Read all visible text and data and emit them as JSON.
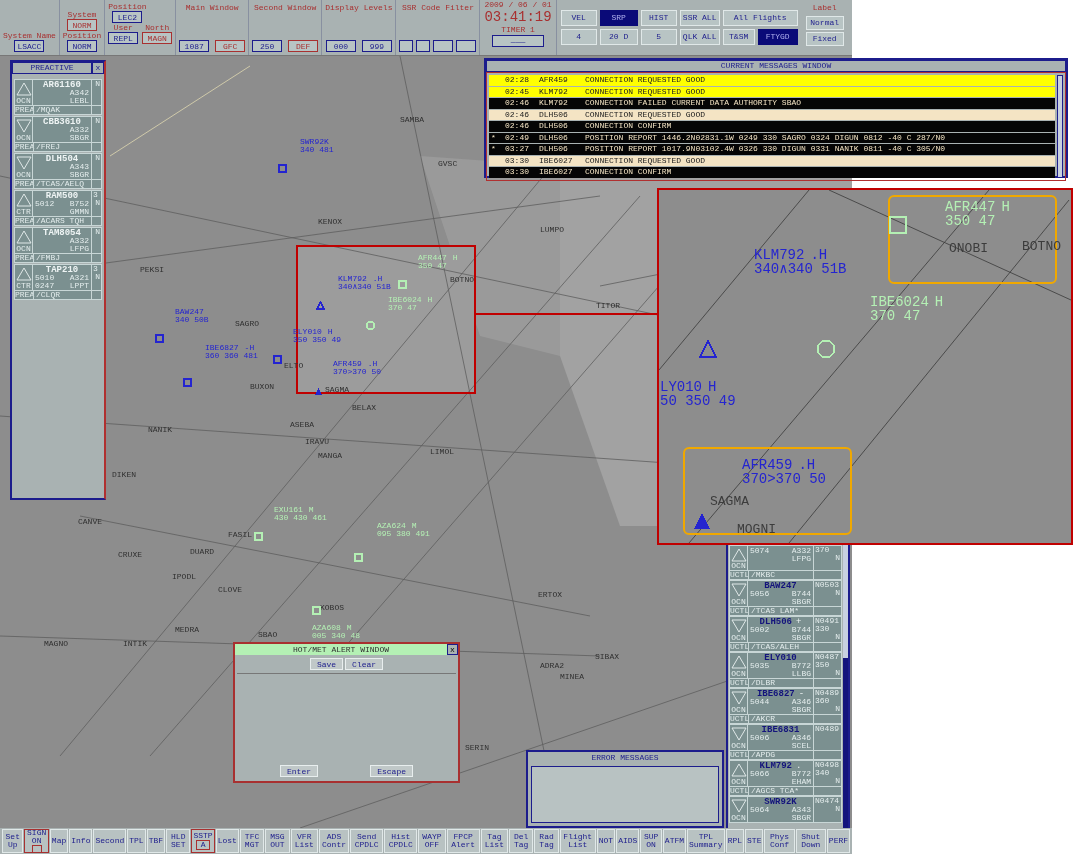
{
  "topbar": {
    "groups": [
      {
        "fields": [
          {
            "label": "System Name",
            "value": "LSACC",
            "kind": "control"
          }
        ]
      },
      {
        "fields": [
          {
            "label": "System",
            "value": "NORM",
            "kind": "setting"
          },
          {
            "label": "Position",
            "value": "NORM",
            "kind": "control"
          }
        ]
      },
      {
        "fields": [
          {
            "label": "Position",
            "value": "LEC2",
            "kind": "control"
          },
          {
            "label": "User",
            "value": "REPL",
            "kind": "control"
          },
          {
            "label": "North",
            "value": "MAGN",
            "kind": "setting"
          }
        ]
      },
      {
        "title": "Main Window",
        "fields": [
          {
            "value": "1087",
            "kind": "control"
          },
          {
            "value": "GFC",
            "kind": "setting"
          }
        ]
      },
      {
        "title": "Second Window",
        "fields": [
          {
            "value": "250",
            "kind": "control"
          },
          {
            "value": "DEF",
            "kind": "setting"
          }
        ]
      },
      {
        "title": "Display Levels",
        "fields": [
          {
            "value": "000",
            "kind": "control"
          },
          {
            "value": "999",
            "kind": "control"
          }
        ]
      },
      {
        "title": "SSR Code Filter"
      }
    ],
    "date": "2009 / 06 / 01",
    "time": "03:41:19",
    "timer_label": "TIMER 1",
    "timer_button": "———",
    "buttons": [
      {
        "label": "VEL",
        "selected": false
      },
      {
        "label": "SRP",
        "selected": true
      },
      {
        "label": "HIST",
        "selected": false
      },
      {
        "label": "SSR ALL",
        "selected": false
      },
      {
        "label": "All Flights",
        "selected": false
      },
      {
        "label": "4",
        "selected": false
      },
      {
        "label": "20 D",
        "selected": false
      },
      {
        "label": "5",
        "selected": false
      },
      {
        "label": "QLK ALL",
        "selected": false
      },
      {
        "label": "T&SM",
        "selected": false
      },
      {
        "label": "FTYGD",
        "selected": true
      }
    ],
    "label_group": {
      "title": "Label",
      "buttons": [
        "Normal",
        "Fixed"
      ]
    }
  },
  "preactive": {
    "title": "PREACTIVE",
    "close": "x",
    "strips": [
      {
        "kind": "up",
        "callsign": "AR61160",
        "type": "A342",
        "dest": "LEBL",
        "sector": "OCN",
        "status": "PREA",
        "info": "/MQAK",
        "tag": "N"
      },
      {
        "kind": "down",
        "callsign": "CBB3610",
        "type": "A332",
        "dest": "SBGR",
        "sector": "OCN",
        "status": "PREA",
        "info": "/FREJ",
        "tag": "N"
      },
      {
        "kind": "down",
        "callsign": "DLH504",
        "type": "A343",
        "dest": "SBGR",
        "sector": "OCN",
        "status": "PREA",
        "info": "/TCAS/AELQ",
        "tag": "N"
      },
      {
        "kind": "up",
        "callsign": "RAM500",
        "ssr": "5012",
        "type": "B752",
        "dest": "GMMN",
        "sector": "CTR",
        "status": "PREA",
        "info": "/ACARS TQH",
        "tag": "N",
        "level": "3"
      },
      {
        "kind": "up",
        "callsign": "TAM8054",
        "type": "A332",
        "dest": "LFPG",
        "sector": "OCN",
        "status": "PREA",
        "info": "/FMBJ",
        "tag": "N"
      },
      {
        "kind": "up",
        "callsign": "TAP210",
        "ssr": "5010",
        "type": "A321",
        "eta": "0247",
        "dest": "LPPT",
        "sector": "CTR",
        "status": "PREA",
        "info": "/CLQR",
        "tag": "N",
        "level": "3"
      }
    ]
  },
  "messages": {
    "title": "CURRENT MESSAGES WINDOW",
    "rows": [
      {
        "time": "02:28",
        "callsign": "AFR459",
        "text": "CONNECTION REQUESTED GOOD",
        "kind": "alert"
      },
      {
        "time": "02:45",
        "callsign": "KLM792",
        "text": "CONNECTION REQUESTED GOOD",
        "kind": "alert"
      },
      {
        "time": "02:46",
        "callsign": "KLM792",
        "text": "CONNECTION FAILED CURRENT DATA AUTHORITY SBAO",
        "kind": "normal"
      },
      {
        "time": "02:46",
        "callsign": "DLH506",
        "text": "CONNECTION REQUESTED GOOD",
        "kind": "notice"
      },
      {
        "time": "02:46",
        "callsign": "DLH506",
        "text": "CONNECTION CONFIRM",
        "kind": "normal"
      },
      {
        "marker": "*",
        "time": "02:49",
        "callsign": "DLH506",
        "text": "POSITION REPORT 1446.2N02831.1W 0249 330 SAGRO 0324 DIGUN 0812 -40 C 287/N0",
        "kind": "normal"
      },
      {
        "marker": "*",
        "time": "03:27",
        "callsign": "DLH506",
        "text": "POSITION REPORT 1017.9N03102.4W 0326 330 DIGUN 0331 NANIK 0811 -40 C 305/N0",
        "kind": "normal"
      },
      {
        "time": "03:30",
        "callsign": "IBE6027",
        "text": "CONNECTION REQUESTED GOOD",
        "kind": "notice"
      },
      {
        "time": "03:30",
        "callsign": "IBE6027",
        "text": "CONNECTION CONFIRM",
        "kind": "normal"
      }
    ]
  },
  "map": {
    "waypoints": [
      {
        "name": "SAMBA"
      },
      {
        "name": "KENOX"
      },
      {
        "name": "PEKSI"
      },
      {
        "name": "SAGRO"
      },
      {
        "name": "ELTO"
      },
      {
        "name": "BUXON"
      },
      {
        "name": "NANIK"
      },
      {
        "name": "BELAX"
      },
      {
        "name": "ASEBA"
      },
      {
        "name": "IRAVU"
      },
      {
        "name": "MANGA"
      },
      {
        "name": "DIKEN"
      },
      {
        "name": "LIMOL"
      },
      {
        "name": "CANVE"
      },
      {
        "name": "CRUXE"
      },
      {
        "name": "FASIL"
      },
      {
        "name": "DUARD"
      },
      {
        "name": "IPODL"
      },
      {
        "name": "CLOVE"
      },
      {
        "name": "KOBOS"
      },
      {
        "name": "SBAO"
      },
      {
        "name": "ERTOX"
      },
      {
        "name": "ADRA2"
      },
      {
        "name": "MINEA"
      },
      {
        "name": "SIBAX"
      },
      {
        "name": "SERIN"
      },
      {
        "name": "MAGNO"
      },
      {
        "name": "INTIK"
      },
      {
        "name": "MEDRA"
      },
      {
        "name": "LUMPO"
      },
      {
        "name": "TITOR"
      },
      {
        "name": "GVSC"
      },
      {
        "name": "BOTNO"
      },
      {
        "name": "SAGMA"
      }
    ],
    "tracks": [
      {
        "callsign": "SWR92K",
        "data": "340 481",
        "color": "#2424d0",
        "kind": "square"
      },
      {
        "callsign": "BAW247",
        "data": "340 50B",
        "color": "#2424d0",
        "kind": "square"
      },
      {
        "callsign": "IBE6827",
        "suffix": "-H",
        "data": "360 360 481",
        "color": "#2424d0",
        "kind": "square"
      },
      {
        "callsign": "KLM792",
        "suffix": ".H",
        "data": "340∧340 51B",
        "color": "#2424d0",
        "kind": "triangle"
      },
      {
        "callsign": "AFR447",
        "suffix": "H",
        "data": "350 47",
        "color": "#b4f0b4",
        "kind": "square"
      },
      {
        "callsign": "IBE6024",
        "suffix": "H",
        "data": "370 47",
        "color": "#b4f0b4",
        "kind": "octagon"
      },
      {
        "callsign": "ELY010",
        "suffix": "H",
        "data": "350 350 49",
        "color": "#2424d0",
        "kind": "square"
      },
      {
        "callsign": "AFR459",
        "suffix": ".H",
        "data": "370>370 50",
        "color": "#2424d0",
        "kind": "filled"
      },
      {
        "callsign": "EXU161",
        "suffix": "M",
        "data": "430 430 461",
        "color": "#b4f0b4",
        "kind": "square"
      },
      {
        "callsign": "AZA624",
        "suffix": "M",
        "data": "095 380 491",
        "color": "#b4f0b4",
        "kind": "square"
      },
      {
        "callsign": "AZA608",
        "suffix": "M",
        "data": "005 340 48",
        "color": "#b4f0b4",
        "kind": "square"
      }
    ]
  },
  "active": {
    "strips": [
      {
        "kind": "up",
        "ssr": "5074",
        "type": "A332",
        "level": "370",
        "dest": "LFPG",
        "flag": "N",
        "sector": "OCN",
        "status": "UCTL",
        "info": "/MKBC"
      },
      {
        "kind": "down",
        "callsign": "BAW247",
        "ssr": "5056",
        "type": "B744",
        "speed": "N0503",
        "dest": "SBGR",
        "flag": "N",
        "sector": "OCN",
        "status": "UCTL",
        "info": "/TCAS LAM*"
      },
      {
        "kind": "down",
        "callsign": "DLH506",
        "mark": "+",
        "ssr": "5002",
        "type": "B744",
        "speed": "N0491",
        "level": "330",
        "dest": "SBGR",
        "flag": "N",
        "sector": "OCN",
        "status": "UCTL",
        "info": "/TCAS/ALEH"
      },
      {
        "kind": "up",
        "callsign": "ELY010",
        "ssr": "5035",
        "type": "B772",
        "speed": "N0487",
        "level": "350",
        "dest": "LLBG",
        "flag": "N",
        "sector": "OCN",
        "status": "UCTL",
        "info": "/DLBR"
      },
      {
        "kind": "down",
        "callsign": "IBE6827",
        "mark": "-",
        "ssr": "5044",
        "type": "A346",
        "speed": "N0489",
        "level": "360",
        "dest": "SBGR",
        "flag": "N",
        "sector": "OCN",
        "status": "UCTL",
        "info": "/AKCR"
      },
      {
        "kind": "down",
        "callsign": "IBE6831",
        "ssr": "5006",
        "type": "A346",
        "speed": "N0489",
        "dest": "SCEL",
        "sector": "OCN",
        "status": "UCTL",
        "info": "/APDG"
      },
      {
        "kind": "up",
        "callsign": "KLM792",
        "mark": ".",
        "ssr": "5066",
        "type": "B772",
        "speed": "N0498",
        "level": "340",
        "dest": "EHAM",
        "flag": "N",
        "sector": "OCN",
        "status": "UCTL",
        "info": "/AGCS TCA*"
      },
      {
        "kind": "down",
        "callsign": "SWR92K",
        "ssr": "5064",
        "type": "A343",
        "speed": "N0474",
        "dest": "SBGR",
        "flag": "N",
        "sector": "OCN"
      }
    ]
  },
  "hotmet": {
    "title": "HOT/MET ALERT WINDOW",
    "close": "x",
    "buttons": [
      "Save",
      "Clear"
    ],
    "footer_buttons": [
      "Enter",
      "Escape"
    ]
  },
  "errors": {
    "title": "ERROR MESSAGES"
  },
  "bottombar": {
    "buttons": [
      {
        "label": "Set Up",
        "kind": "plain"
      },
      {
        "label": "SIGN ON",
        "kind": "split"
      },
      {
        "label": "Map",
        "kind": "plain"
      },
      {
        "label": "Info",
        "kind": "plain"
      },
      {
        "label": "Second",
        "kind": "plain"
      },
      {
        "label": "TPL",
        "kind": "plain"
      },
      {
        "label": "TBF",
        "kind": "plain"
      },
      {
        "label": "HLD SET",
        "kind": "plain"
      },
      {
        "label": "SSTP",
        "kind": "split",
        "sub": "A"
      },
      {
        "label": "Lost",
        "kind": "plain"
      },
      {
        "label": "TFC MGT",
        "kind": "plain"
      },
      {
        "label": "MSG OUT",
        "kind": "plain"
      },
      {
        "label": "VFR List",
        "kind": "plain"
      },
      {
        "label": "ADS Contr",
        "kind": "plain"
      },
      {
        "label": "Send CPDLC",
        "kind": "plain"
      },
      {
        "label": "Hist CPDLC",
        "kind": "plain"
      },
      {
        "label": "WAYP OFF",
        "kind": "plain"
      },
      {
        "label": "FPCP Alert",
        "kind": "plain"
      },
      {
        "label": "Tag List",
        "kind": "plain"
      },
      {
        "label": "Del Tag",
        "kind": "plain"
      },
      {
        "label": "Rad Tag",
        "kind": "plain"
      },
      {
        "label": "Flight List",
        "kind": "plain"
      },
      {
        "label": "NOT",
        "kind": "plain"
      },
      {
        "label": "AIDS",
        "kind": "plain"
      },
      {
        "label": "SUP ON",
        "kind": "plain"
      },
      {
        "label": "ATFM",
        "kind": "plain"
      },
      {
        "label": "TPL Summary",
        "kind": "plain"
      },
      {
        "label": "RPL",
        "kind": "plain"
      },
      {
        "label": "STE",
        "kind": "plain"
      },
      {
        "label": "Phys Conf",
        "kind": "plain"
      },
      {
        "label": "Shut Down",
        "kind": "plain"
      },
      {
        "label": "PERF",
        "kind": "plain"
      }
    ]
  },
  "inset": {
    "waypoints": [
      {
        "name": "ONOBI"
      },
      {
        "name": "BOTNO"
      },
      {
        "name": "SAGMA"
      },
      {
        "name": "MOGNI"
      }
    ],
    "tracks": [
      {
        "callsign": "KLM792",
        "suffix": ".H",
        "data": "340∧340 51B",
        "color": "#2424d0",
        "kind": "triangle",
        "highlighted": false
      },
      {
        "callsign": "AFR447",
        "suffix": "H",
        "data": "350 47",
        "color": "#b4f0b4",
        "kind": "square",
        "highlighted": true
      },
      {
        "callsign": "IBE6024",
        "suffix": "H",
        "data": "370 47",
        "color": "#b4f0b4",
        "kind": "octagon",
        "highlighted": false
      },
      {
        "callsign": "LY010",
        "suffix": "H",
        "data": "50 350 49",
        "color": "#2424d0",
        "highlighted": false
      },
      {
        "callsign": "AFR459",
        "suffix": ".H",
        "data": "370>370 50",
        "color": "#2424d0",
        "kind": "filled",
        "highlighted": true
      }
    ]
  }
}
